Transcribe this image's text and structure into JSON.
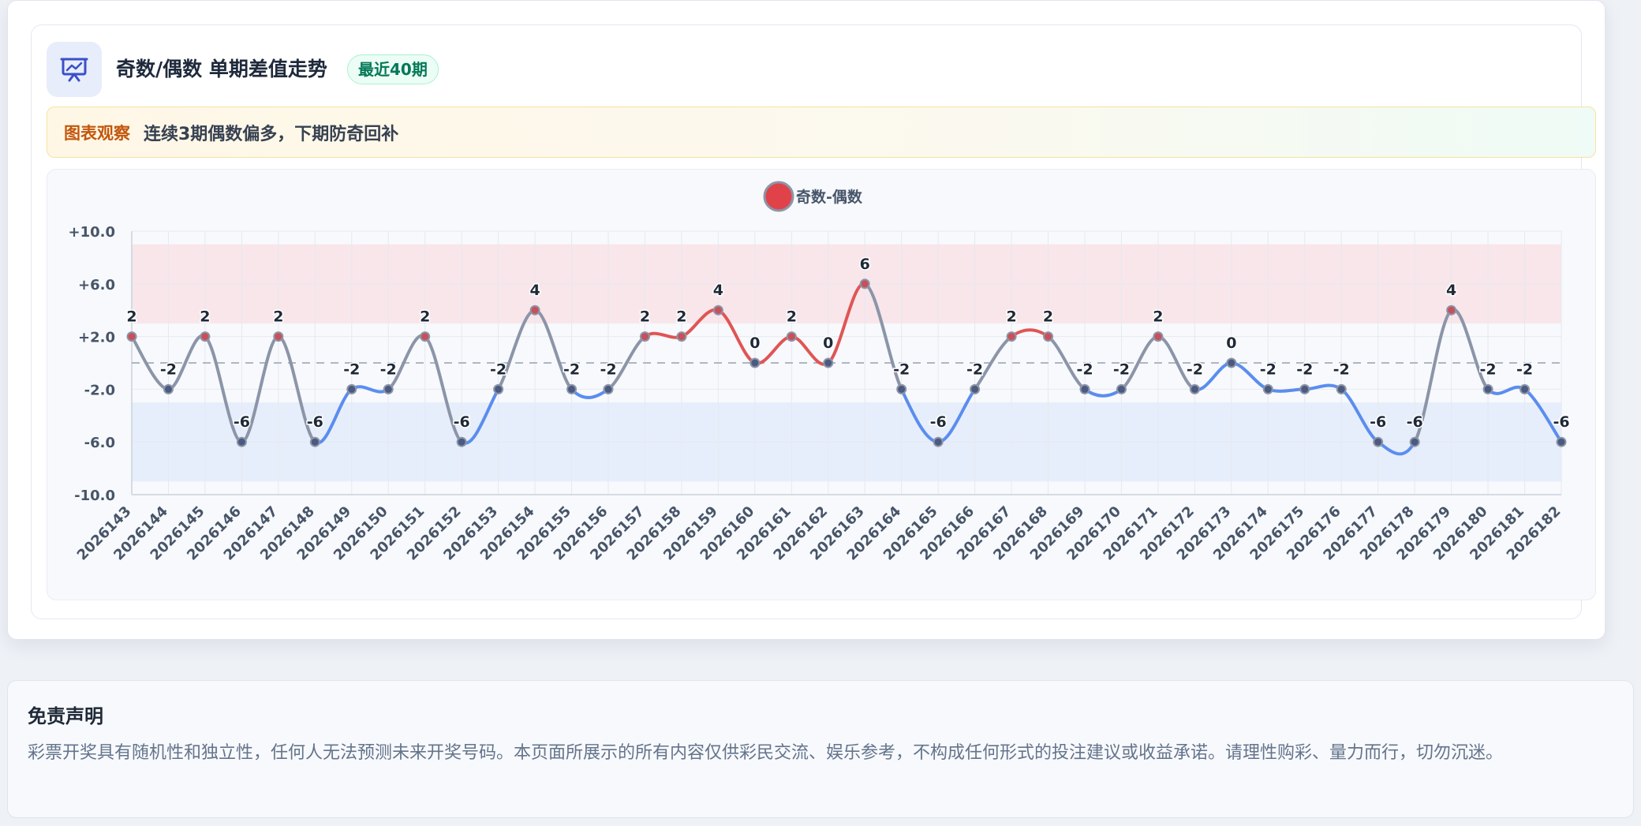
{
  "header": {
    "title": "奇数/偶数 单期差值走势",
    "badge": "最近40期"
  },
  "observation": {
    "label": "图表观察",
    "text": "连续3期偶数偏多，下期防奇回补"
  },
  "colors": {
    "odd_dominant": "#e05555",
    "even_dominant": "#5b8def",
    "balanced": "#8c95a8",
    "odd_band": "#f8e6ea",
    "even_band": "#e7eefb"
  },
  "chart_data": {
    "type": "line",
    "legend": {
      "label": "奇数-偶数",
      "position": "top-center"
    },
    "categories": [
      "2026143",
      "2026144",
      "2026145",
      "2026146",
      "2026147",
      "2026148",
      "2026149",
      "2026150",
      "2026151",
      "2026152",
      "2026153",
      "2026154",
      "2026155",
      "2026156",
      "2026157",
      "2026158",
      "2026159",
      "2026160",
      "2026161",
      "2026162",
      "2026163",
      "2026164",
      "2026165",
      "2026166",
      "2026167",
      "2026168",
      "2026169",
      "2026170",
      "2026171",
      "2026172",
      "2026173",
      "2026174",
      "2026175",
      "2026176",
      "2026177",
      "2026178",
      "2026179",
      "2026180",
      "2026181",
      "2026182"
    ],
    "series": [
      {
        "name": "奇数-偶数",
        "values": [
          2,
          -2,
          2,
          -6,
          2,
          -6,
          -2,
          -2,
          2,
          -6,
          -2,
          4,
          -2,
          -2,
          2,
          2,
          4,
          0,
          2,
          0,
          6,
          -2,
          -6,
          -2,
          2,
          2,
          -2,
          -2,
          2,
          -2,
          0,
          -2,
          -2,
          -2,
          -6,
          -6,
          4,
          -2,
          -2,
          -6
        ]
      }
    ],
    "y_ticks": [
      "+10.0",
      "+6.0",
      "+2.0",
      "-2.0",
      "-6.0",
      "-10.0"
    ],
    "ylim": [
      -10,
      10
    ],
    "reference_line": 0,
    "bands": [
      {
        "from": 3,
        "to": 9,
        "meaning": "odd-heavy"
      },
      {
        "from": -9,
        "to": -3,
        "meaning": "even-heavy"
      }
    ],
    "grid": true
  },
  "disclaimer": {
    "title": "免责声明",
    "text": "彩票开奖具有随机性和独立性，任何人无法预测未来开奖号码。本页面所展示的所有内容仅供彩民交流、娱乐参考，不构成任何形式的投注建议或收益承诺。请理性购彩、量力而行，切勿沉迷。"
  }
}
